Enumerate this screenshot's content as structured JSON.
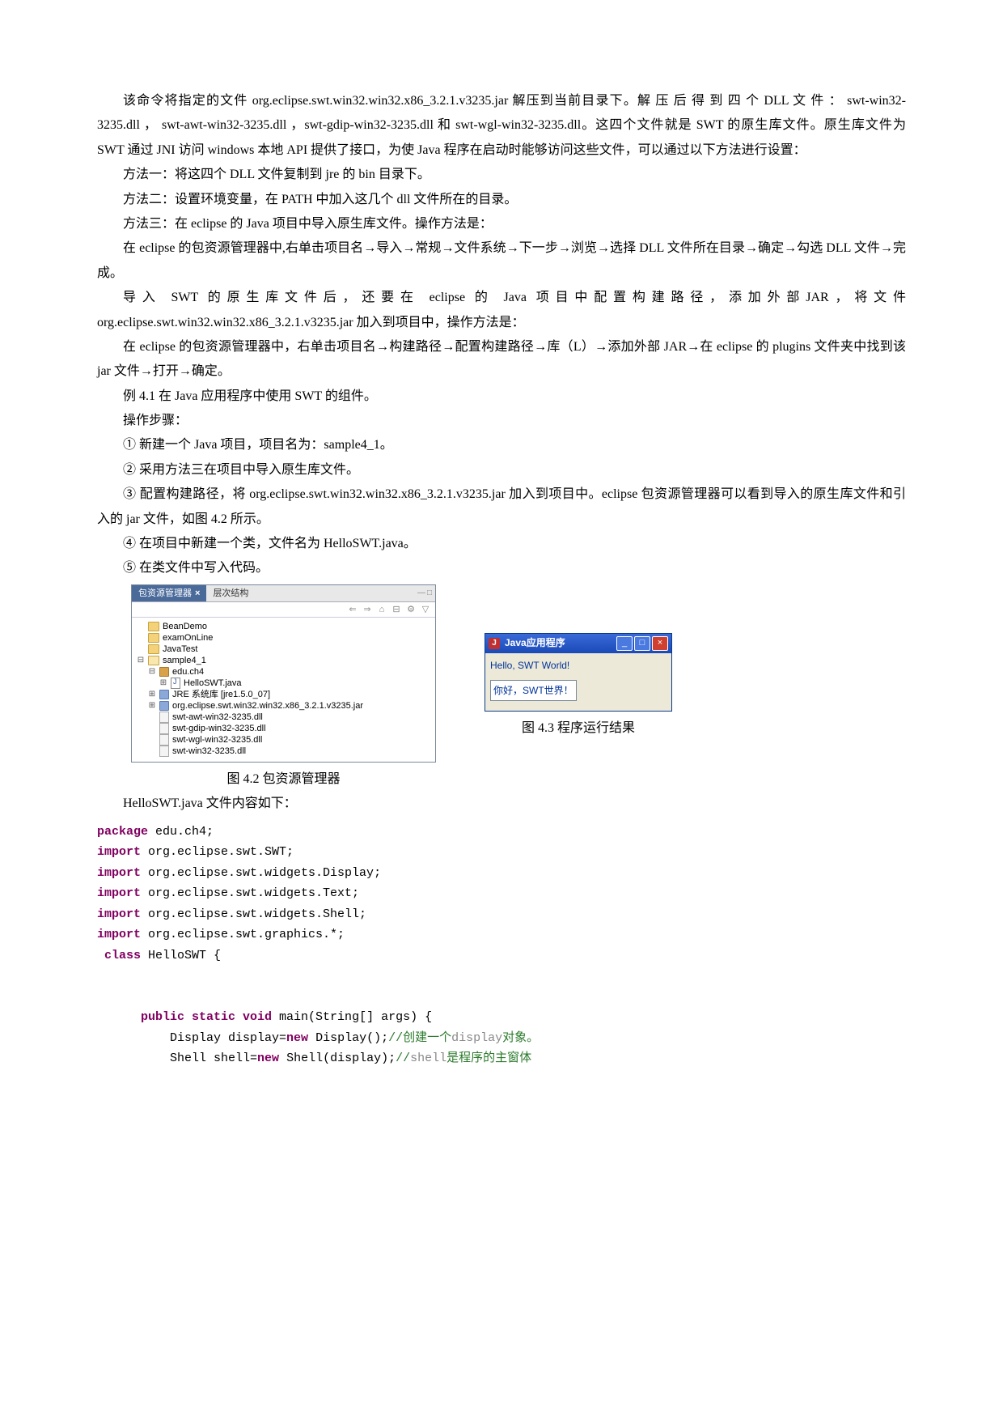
{
  "paragraphs": {
    "p1": "该命令将指定的文件 org.eclipse.swt.win32.win32.x86_3.2.1.v3235.jar 解压到当前目录下。解 压 后 得 到 四 个 DLL  文 件 ： swt-win32-3235.dll ， swt-awt-win32-3235.dll ，swt-gdip-win32-3235.dll 和 swt-wgl-win32-3235.dll。这四个文件就是 SWT 的原生库文件。原生库文件为 SWT 通过 JNI 访问 windows 本地 API 提供了接口，为使 Java 程序在启动时能够访问这些文件，可以通过以下方法进行设置：",
    "m1": "方法一：将这四个 DLL 文件复制到 jre 的 bin 目录下。",
    "m2": "方法二：设置环境变量，在 PATH 中加入这几个 dll 文件所在的目录。",
    "m3": "方法三：在 eclipse 的 Java 项目中导入原生库文件。操作方法是：",
    "p2": "在 eclipse 的包资源管理器中,右单击项目名→导入→常规→文件系统→下一步→浏览→选择 DLL 文件所在目录→确定→勾选 DLL 文件→完成。",
    "p3": "导入 SWT 的原生库文件后，还要在 eclipse 的 Java 项目中配置构建路径，添加外部JAR，将文件 org.eclipse.swt.win32.win32.x86_3.2.1.v3235.jar 加入到项目中，操作方法是：",
    "p4": "在 eclipse 的包资源管理器中，右单击项目名→构建路径→配置构建路径→库（L）→添加外部 JAR→在 eclipse 的 plugins 文件夹中找到该 jar 文件→打开→确定。",
    "ex": "例 4.1  在 Java 应用程序中使用 SWT 的组件。",
    "steps_label": "操作步骤：",
    "s1": "① 新建一个 Java 项目，项目名为：sample4_1。",
    "s2": "② 采用方法三在项目中导入原生库文件。",
    "s3": "③ 配置构建路径，将 org.eclipse.swt.win32.win32.x86_3.2.1.v3235.jar 加入到项目中。eclipse 包资源管理器可以看到导入的原生库文件和引入的 jar 文件，如图 4.2 所示。",
    "s4": "④ 在项目中新建一个类，文件名为 HelloSWT.java。",
    "s5": "⑤ 在类文件中写入代码。",
    "after_fig": "HelloSWT.java 文件内容如下："
  },
  "pkg": {
    "tab_active": "包资源管理器",
    "tab_other": "层次结构",
    "nodes": {
      "beanDemo": "BeanDemo",
      "examOnLine": "examOnLine",
      "javaTest": "JavaTest",
      "sample": "sample4_1",
      "eduPkg": "edu.ch4",
      "helloJava": "HelloSWT.java",
      "jre": "JRE 系统库 [jre1.5.0_07]",
      "swtJar": "org.eclipse.swt.win32.win32.x86_3.2.1.v3235.jar",
      "dll1": "swt-awt-win32-3235.dll",
      "dll2": "swt-gdip-win32-3235.dll",
      "dll3": "swt-wgl-win32-3235.dll",
      "dll4": "swt-win32-3235.dll"
    },
    "caption": "图 4.2 包资源管理器"
  },
  "app": {
    "title": "Java应用程序",
    "line1": "Hello, SWT World!",
    "line2": "你好，SWT世界！",
    "caption": "图 4.3 程序运行结果"
  },
  "code": {
    "l1a": "package",
    "l1b": " edu.ch4;",
    "l2a": "import",
    "l2b": " org.eclipse.swt.SWT;",
    "l3a": "import",
    "l3b": " org.eclipse.swt.widgets.Display;",
    "l4a": "import",
    "l4b": " org.eclipse.swt.widgets.Text;",
    "l5a": "import",
    "l5b": " org.eclipse.swt.widgets.Shell;",
    "l6a": "import",
    "l6b": " org.eclipse.swt.graphics.*;",
    "l7a": " class",
    "l7b": " HelloSWT {",
    "l8a": "      public static void",
    "l8b": " main(String[] args) {",
    "l9a": "          Display display=",
    "l9b": "new",
    "l9c": " Display();",
    "l9d": "//创建一个",
    "l9e": "display",
    "l9f": "对象。",
    "l10a": "          Shell shell=",
    "l10b": "new",
    "l10c": " Shell(display);",
    "l10d": "//",
    "l10e": "shell",
    "l10f": "是程序的主窗体"
  }
}
